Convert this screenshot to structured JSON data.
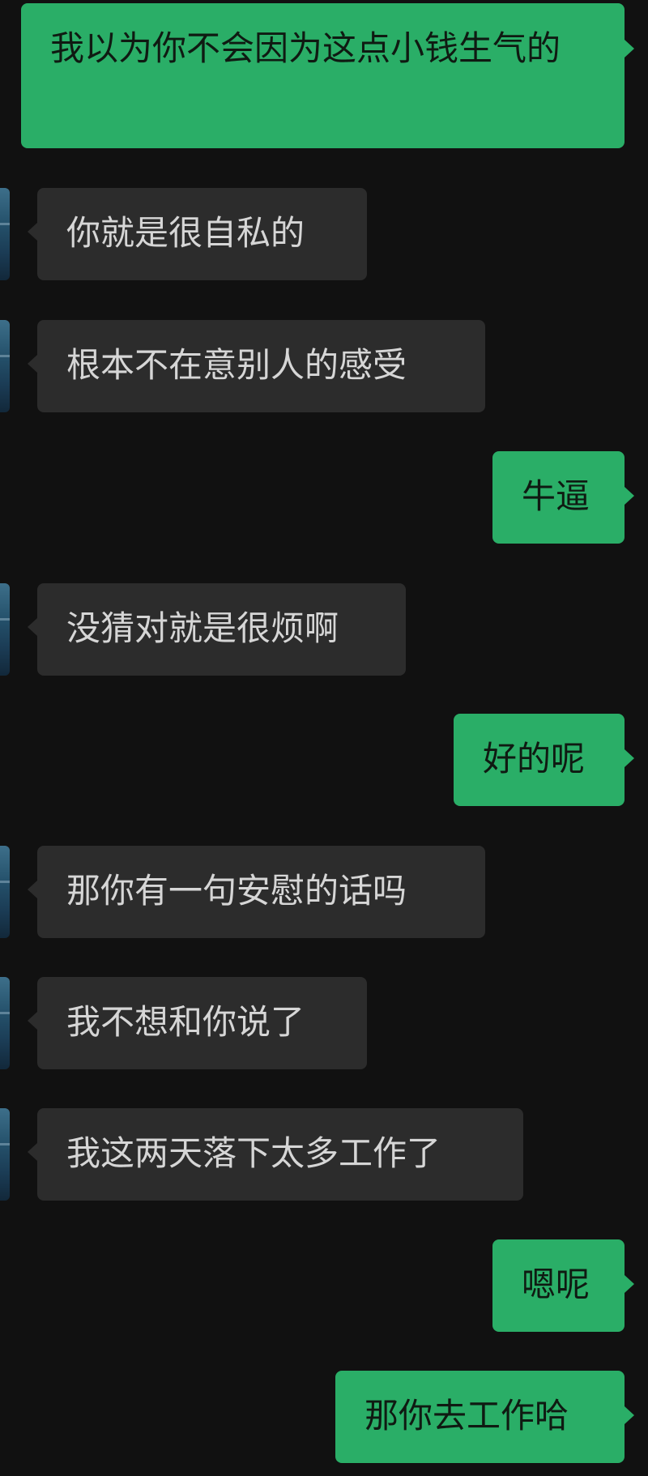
{
  "messages": [
    {
      "side": "out",
      "text": "我以为你不会因为这点小钱生气的"
    },
    {
      "side": "in",
      "text": "你就是很自私的"
    },
    {
      "side": "in",
      "text": "根本不在意别人的感受"
    },
    {
      "side": "out",
      "text": "牛逼"
    },
    {
      "side": "in",
      "text": "没猜对就是很烦啊"
    },
    {
      "side": "out",
      "text": "好的呢"
    },
    {
      "side": "in",
      "text": "那你有一句安慰的话吗"
    },
    {
      "side": "in",
      "text": "我不想和你说了"
    },
    {
      "side": "in",
      "text": "我这两天落下太多工作了"
    },
    {
      "side": "out",
      "text": "嗯呢"
    },
    {
      "side": "out",
      "text": "那你去工作哈"
    }
  ],
  "colors": {
    "background": "#111111",
    "incoming_bubble": "#2c2c2c",
    "outgoing_bubble": "#2aae67"
  }
}
